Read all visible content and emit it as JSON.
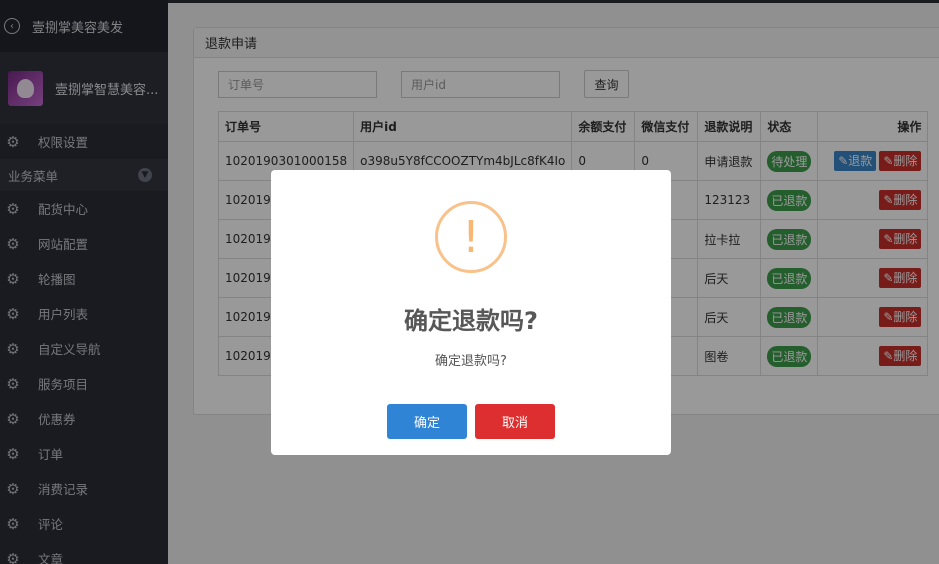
{
  "sidebar": {
    "app_title": "壹捌掌美容美发",
    "user_name": "壹捌掌智慧美容...",
    "top_item": "权限设置",
    "section_title": "业务菜单",
    "items": [
      {
        "label": "配货中心"
      },
      {
        "label": "网站配置"
      },
      {
        "label": "轮播图"
      },
      {
        "label": "用户列表"
      },
      {
        "label": "自定义导航"
      },
      {
        "label": "服务项目"
      },
      {
        "label": "优惠券"
      },
      {
        "label": "订单"
      },
      {
        "label": "消费记录"
      },
      {
        "label": "评论"
      },
      {
        "label": "文章"
      }
    ]
  },
  "panel": {
    "title": "退款申请",
    "search": {
      "order_placeholder": "订单号",
      "user_placeholder": "用户id",
      "query_label": "查询"
    },
    "table": {
      "headers": [
        "订单号",
        "用户id",
        "余额支付",
        "微信支付",
        "退款说明",
        "状态",
        "操作"
      ],
      "rows": [
        {
          "order": "1020190301000158",
          "user": "o398u5Y8fCCOOZTYm4bJLc8fK4Io",
          "balance": "0",
          "wechat": "0",
          "note": "申请退款",
          "status": "待处理",
          "refund_btn": "退款",
          "delete_btn": "删除"
        },
        {
          "order": "1020190",
          "user": "",
          "balance": "",
          "wechat": "",
          "note": "123123",
          "status": "已退款",
          "delete_btn": "删除"
        },
        {
          "order": "1020190",
          "user": "",
          "balance": "",
          "wechat": "",
          "note": "拉卡拉",
          "status": "已退款",
          "delete_btn": "删除"
        },
        {
          "order": "1020190",
          "user": "",
          "balance": "",
          "wechat": "",
          "note": "后天",
          "status": "已退款",
          "delete_btn": "删除"
        },
        {
          "order": "1020190",
          "user": "",
          "balance": "",
          "wechat": "",
          "note": "后天",
          "status": "已退款",
          "delete_btn": "删除"
        },
        {
          "order": "1020190",
          "user": "",
          "balance": "",
          "wechat": "",
          "note": "图卷",
          "status": "已退款",
          "delete_btn": "删除"
        }
      ]
    }
  },
  "modal": {
    "icon": "!",
    "title": "确定退款吗?",
    "text": "确定退款吗?",
    "confirm_label": "确定",
    "cancel_label": "取消"
  },
  "colors": {
    "sidebar_bg": "#2b2e37",
    "confirm": "#2f84d6",
    "cancel": "#dd2f2f",
    "warning": "#f8c28a",
    "status_green": "#3c9d4b"
  }
}
